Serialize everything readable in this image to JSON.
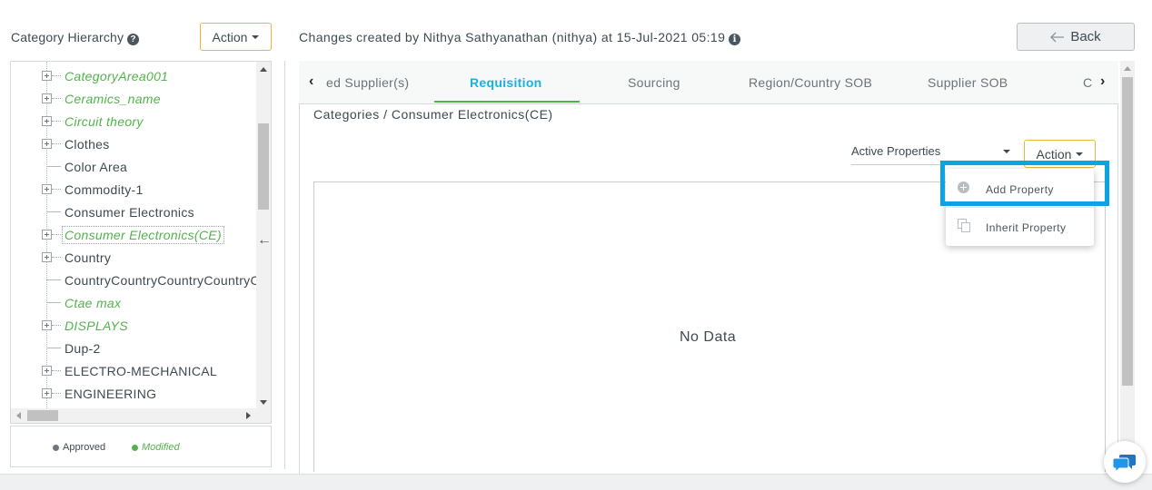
{
  "left_panel": {
    "title": "Category Hierarchy",
    "help_icon": "?",
    "action_label": "Action",
    "tree_items": [
      {
        "label": "CategoryArea001",
        "status": "modified",
        "expandable": true
      },
      {
        "label": "Ceramics_name",
        "status": "modified",
        "expandable": true
      },
      {
        "label": "Circuit theory",
        "status": "modified",
        "expandable": true
      },
      {
        "label": "Clothes",
        "status": "approved",
        "expandable": true
      },
      {
        "label": "Color Area",
        "status": "approved",
        "expandable": false
      },
      {
        "label": "Commodity-1",
        "status": "approved",
        "expandable": true
      },
      {
        "label": "Consumer Electronics",
        "status": "approved",
        "expandable": false
      },
      {
        "label": "Consumer Electronics(CE)",
        "status": "modified-selected",
        "expandable": true
      },
      {
        "label": "Country",
        "status": "approved",
        "expandable": true
      },
      {
        "label": "CountryCountryCountryCountryCountry",
        "status": "approved",
        "expandable": false
      },
      {
        "label": "Ctae max",
        "status": "modified",
        "expandable": false
      },
      {
        "label": "DISPLAYS",
        "status": "modified",
        "expandable": true
      },
      {
        "label": "Dup-2",
        "status": "approved",
        "expandable": false
      },
      {
        "label": "ELECTRO-MECHANICAL",
        "status": "approved",
        "expandable": true
      },
      {
        "label": "ENGINEERING",
        "status": "approved",
        "expandable": true
      }
    ],
    "legend": {
      "approved_label": "Approved",
      "modified_label": "Modified",
      "approved_color": "#6d777d",
      "modified_color": "#53b24c"
    },
    "collapse_icon": "←"
  },
  "header": {
    "changes_text": "Changes created by Nithya Sathyanathan (nithya) at 15-Jul-2021 05:19",
    "info_icon": "i",
    "back_label": "Back"
  },
  "tabs": {
    "prev_icon": "‹",
    "next_icon": "›",
    "items": [
      {
        "label": "ed Supplier(s)",
        "active": false
      },
      {
        "label": "Requisition",
        "active": true
      },
      {
        "label": "Sourcing",
        "active": false
      },
      {
        "label": "Region/Country SOB",
        "active": false
      },
      {
        "label": "Supplier SOB",
        "active": false
      },
      {
        "label": "C",
        "active": false
      }
    ]
  },
  "content": {
    "breadcrumb": "Categories / Consumer Electronics(CE)",
    "properties_filter": "Active Properties",
    "action_label": "Action",
    "empty_text": "No Data"
  },
  "action_menu": {
    "items": [
      {
        "label": "Add Property",
        "icon": "plus-circle-icon"
      },
      {
        "label": "Inherit Property",
        "icon": "copy-icon"
      }
    ],
    "highlight_color": "#0ba3e0"
  },
  "colors": {
    "accent_blue": "#1ab2dc",
    "active_underline": "#53b24c",
    "action_border": "#f0b43c"
  }
}
